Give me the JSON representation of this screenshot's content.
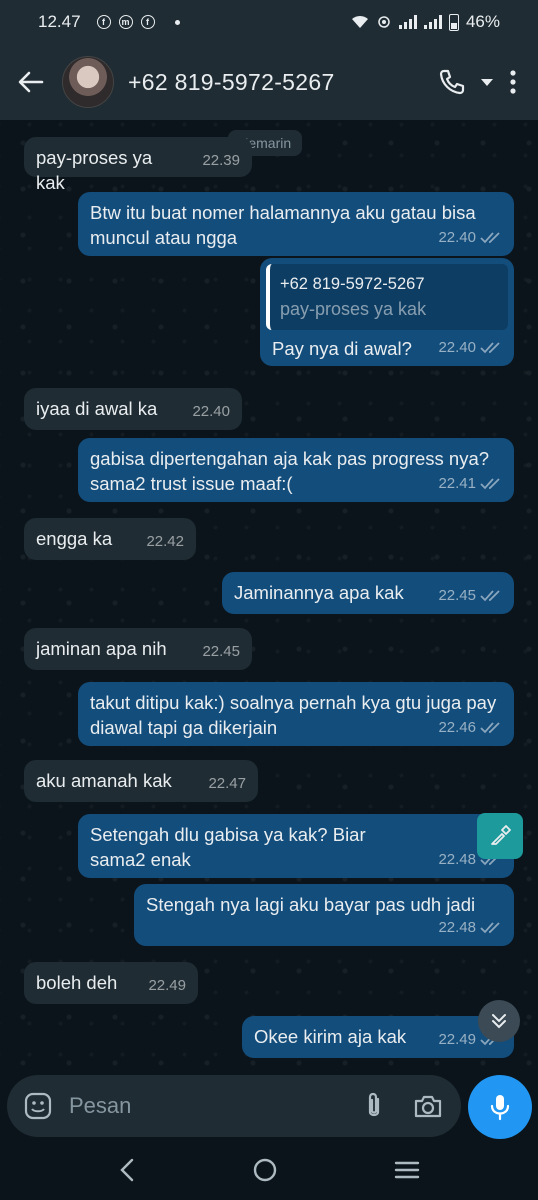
{
  "status": {
    "time": "12.47",
    "battery": "46%"
  },
  "header": {
    "contact": "+62 819-5972-5267"
  },
  "chat": {
    "date_chip": "Kemarin",
    "messages": [
      {
        "dir": "in",
        "text": "pay-proses ya kak",
        "time": "22.39"
      },
      {
        "dir": "out",
        "text": "Btw itu buat nomer halamannya aku gatau bisa muncul atau ngga",
        "time": "22.40"
      },
      {
        "dir": "out",
        "quote_name": "+62 819-5972-5267",
        "quote_text": "pay-proses ya kak",
        "text": "Pay nya di awal?",
        "time": "22.40"
      },
      {
        "dir": "in",
        "text": "iyaa di awal ka",
        "time": "22.40"
      },
      {
        "dir": "out",
        "text": "gabisa dipertengahan aja kak pas progress nya? sama2 trust issue maaf:(",
        "time": "22.41"
      },
      {
        "dir": "in",
        "text": "engga ka",
        "time": "22.42"
      },
      {
        "dir": "out",
        "text": "Jaminannya apa kak",
        "time": "22.45"
      },
      {
        "dir": "in",
        "text": "jaminan apa nih",
        "time": "22.45"
      },
      {
        "dir": "out",
        "text": "takut ditipu kak:) soalnya pernah kya gtu juga pay diawal tapi ga dikerjain",
        "time": "22.46"
      },
      {
        "dir": "in",
        "text": "aku amanah kak",
        "time": "22.47"
      },
      {
        "dir": "out",
        "text": "Setengah dlu gabisa ya kak? Biar sama2 enak",
        "time": "22.48"
      },
      {
        "dir": "out",
        "text": "Stengah nya lagi aku bayar pas udh jadi",
        "time": "22.48"
      },
      {
        "dir": "in",
        "text": "boleh deh",
        "time": "22.49"
      },
      {
        "dir": "out",
        "text": "Okee kirim aja kak",
        "time": "22.49"
      }
    ]
  },
  "input": {
    "placeholder": "Pesan"
  },
  "colors": {
    "incoming": "#1f2c33",
    "outgoing": "#134d7c",
    "mic": "#2197f3",
    "background": "#0b141a"
  }
}
